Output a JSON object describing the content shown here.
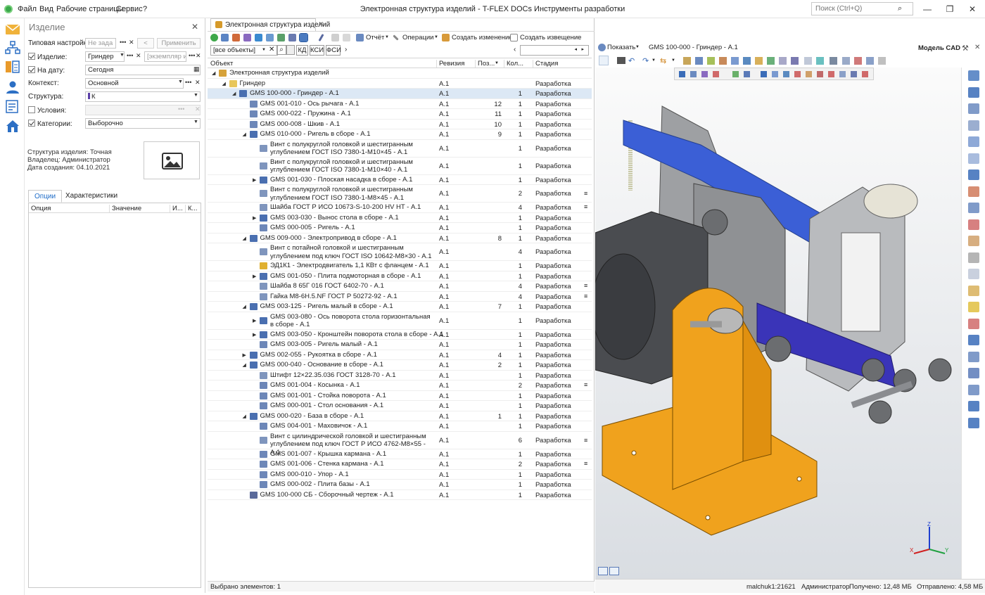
{
  "menu": [
    "Файл",
    "Вид",
    "Рабочие страницы",
    "Сервис",
    "?"
  ],
  "app_title": "Электронная структура изделий - T-FLEX DOCs Инструменты разработки",
  "search_placeholder": "Поиск (Ctrl+Q)",
  "window_buttons": {
    "min": "—",
    "max": "❐",
    "close": "✕"
  },
  "left": {
    "title": "Изделие",
    "fields": {
      "template_label": "Типовая настройка:",
      "template_value": "Не зада",
      "apply": "Применить",
      "back": "<",
      "product_label": "Изделие:",
      "product_value": "Гриндер",
      "instance_placeholder": "[экземпляр и",
      "date_label": "На дату:",
      "date_value": "Сегодня",
      "context_label": "Контекст:",
      "context_value": "Основной",
      "structure_label": "Структура:",
      "structure_value": "К",
      "conditions_label": "Условия:",
      "categories_label": "Категории:",
      "categories_value": "Выборочно"
    },
    "info": {
      "structure_label": "Структура изделия:",
      "structure_value": "Точная",
      "owner_label": "Владелец:",
      "owner_value": "Администратор",
      "created_label": "Дата создания:",
      "created_value": "04.10.2021"
    },
    "tabs": [
      "Опции",
      "Характеристики"
    ],
    "table_headers": [
      "Опция",
      "Значение",
      "И...",
      "К..."
    ]
  },
  "middle": {
    "tab_title": "Электронная структура изделий",
    "toolbar": {
      "report": "Отчёт",
      "operations": "Операции",
      "create_change": "Создать изменение",
      "create_notice": "Создать извещение"
    },
    "filter": {
      "combo": "[все объекты]",
      "kd": "КД",
      "ksi": "КСИ",
      "fsi": "ФСИ"
    },
    "columns": [
      "Объект",
      "Ревизия",
      "Поз...",
      "Кол...",
      "Стадия"
    ],
    "rows": [
      {
        "exp": "◢",
        "indent": 0,
        "type": "root",
        "name": "Электронная структура изделий",
        "rev": "",
        "pos": "",
        "qty": "",
        "stage": "",
        "mark": ""
      },
      {
        "exp": "◢",
        "indent": 1,
        "type": "folder",
        "name": "Гриндер",
        "rev": "А.1",
        "pos": "",
        "qty": "",
        "stage": "Разработка",
        "mark": ""
      },
      {
        "exp": "◢",
        "indent": 2,
        "type": "asm",
        "name": "GMS 100-000 - Гриндер - А.1",
        "rev": "А.1",
        "pos": "",
        "qty": "1",
        "stage": "Разработка",
        "mark": "",
        "sel": true
      },
      {
        "exp": "",
        "indent": 3,
        "type": "part",
        "name": "GMS 001-010 - Ось рычага - А.1",
        "rev": "А.1",
        "pos": "12",
        "qty": "1",
        "stage": "Разработка",
        "mark": ""
      },
      {
        "exp": "",
        "indent": 3,
        "type": "part",
        "name": "GMS 000-022 - Пружина - А.1",
        "rev": "А.1",
        "pos": "11",
        "qty": "1",
        "stage": "Разработка",
        "mark": ""
      },
      {
        "exp": "",
        "indent": 3,
        "type": "part",
        "name": "GMS 000-008 - Шкив - А.1",
        "rev": "А.1",
        "pos": "10",
        "qty": "1",
        "stage": "Разработка",
        "mark": ""
      },
      {
        "exp": "◢",
        "indent": 3,
        "type": "asm",
        "name": "GMS 010-000 - Ригель в сборе - А.1",
        "rev": "А.1",
        "pos": "9",
        "qty": "1",
        "stage": "Разработка",
        "mark": ""
      },
      {
        "exp": "",
        "indent": 4,
        "type": "std",
        "name": "Винт с полукруглой головкой и шестигранным углублением ГОСТ ISO 7380-1-M10×45 - А.1",
        "rev": "А.1",
        "pos": "",
        "qty": "1",
        "stage": "Разработка",
        "mark": "",
        "tall": true
      },
      {
        "exp": "",
        "indent": 4,
        "type": "std",
        "name": "Винт с полукруглой головкой и шестигранным углублением ГОСТ ISO 7380-1-M10×40 - А.1",
        "rev": "А.1",
        "pos": "",
        "qty": "1",
        "stage": "Разработка",
        "mark": "",
        "tall": true
      },
      {
        "exp": "▶",
        "indent": 4,
        "type": "asm",
        "name": "GMS 001-030 - Плоская насадка в сборе - А.1",
        "rev": "А.1",
        "pos": "",
        "qty": "1",
        "stage": "Разработка",
        "mark": ""
      },
      {
        "exp": "",
        "indent": 4,
        "type": "std",
        "name": "Винт с полукруглой головкой и шестигранным углублением ГОСТ ISO 7380-1-M8×45 - А.1",
        "rev": "А.1",
        "pos": "",
        "qty": "2",
        "stage": "Разработка",
        "mark": "≡",
        "tall": true
      },
      {
        "exp": "",
        "indent": 4,
        "type": "std",
        "name": "Шайба ГОСТ Р ИСО 10673-S-10-200 HV HT - А.1",
        "rev": "А.1",
        "pos": "",
        "qty": "4",
        "stage": "Разработка",
        "mark": "≡"
      },
      {
        "exp": "▶",
        "indent": 4,
        "type": "asm",
        "name": "GMS 003-030 - Вынос стола в сборе - А.1",
        "rev": "А.1",
        "pos": "",
        "qty": "1",
        "stage": "Разработка",
        "mark": ""
      },
      {
        "exp": "",
        "indent": 4,
        "type": "part",
        "name": "GMS 000-005 - Ригель - А.1",
        "rev": "А.1",
        "pos": "",
        "qty": "1",
        "stage": "Разработка",
        "mark": ""
      },
      {
        "exp": "◢",
        "indent": 3,
        "type": "asm",
        "name": "GMS 009-000 - Электропривод в сборе - А.1",
        "rev": "А.1",
        "pos": "8",
        "qty": "1",
        "stage": "Разработка",
        "mark": ""
      },
      {
        "exp": "",
        "indent": 4,
        "type": "std",
        "name": "Винт с потайной головкой и шестигранным углублением под ключ ГОСТ ISO 10642-M8×30 - А.1",
        "rev": "А.1",
        "pos": "",
        "qty": "4",
        "stage": "Разработка",
        "mark": "",
        "tall": true
      },
      {
        "exp": "",
        "indent": 4,
        "type": "buy",
        "name": "ЭД1К1 - Электродвигатель 1,1 КВт с фланцем - А.1",
        "rev": "А.1",
        "pos": "",
        "qty": "1",
        "stage": "Разработка",
        "mark": ""
      },
      {
        "exp": "▶",
        "indent": 4,
        "type": "asm",
        "name": "GMS 001-050 - Плита подмоторная в сборе - А.1",
        "rev": "А.1",
        "pos": "",
        "qty": "1",
        "stage": "Разработка",
        "mark": ""
      },
      {
        "exp": "",
        "indent": 4,
        "type": "std",
        "name": "Шайба 8 65Г 016 ГОСТ 6402-70 - А.1",
        "rev": "А.1",
        "pos": "",
        "qty": "4",
        "stage": "Разработка",
        "mark": "≡"
      },
      {
        "exp": "",
        "indent": 4,
        "type": "std",
        "name": "Гайка M8-6H.5.NF ГОСТ Р 50272-92 - А.1",
        "rev": "А.1",
        "pos": "",
        "qty": "4",
        "stage": "Разработка",
        "mark": "≡"
      },
      {
        "exp": "◢",
        "indent": 3,
        "type": "asm",
        "name": "GMS 003-125 - Ригель малый в сборе - А.1",
        "rev": "А.1",
        "pos": "7",
        "qty": "1",
        "stage": "Разработка",
        "mark": ""
      },
      {
        "exp": "▶",
        "indent": 4,
        "type": "asm",
        "name": "GMS 003-080 - Ось поворота стола горизонтальная в сборе - А.1",
        "rev": "А.1",
        "pos": "",
        "qty": "1",
        "stage": "Разработка",
        "mark": "",
        "tall": true
      },
      {
        "exp": "▶",
        "indent": 4,
        "type": "asm",
        "name": "GMS 003-050 - Кронштейн поворота стола в сборе - А.1",
        "rev": "А.1",
        "pos": "",
        "qty": "1",
        "stage": "Разработка",
        "mark": ""
      },
      {
        "exp": "",
        "indent": 4,
        "type": "part",
        "name": "GMS 003-005 - Ригель малый - А.1",
        "rev": "А.1",
        "pos": "",
        "qty": "1",
        "stage": "Разработка",
        "mark": ""
      },
      {
        "exp": "▶",
        "indent": 3,
        "type": "asm",
        "name": "GMS 002-055 - Рукоятка в сборе - А.1",
        "rev": "А.1",
        "pos": "4",
        "qty": "1",
        "stage": "Разработка",
        "mark": ""
      },
      {
        "exp": "◢",
        "indent": 3,
        "type": "asm",
        "name": "GMS 000-040 - Основание в сборе - А.1",
        "rev": "А.1",
        "pos": "2",
        "qty": "1",
        "stage": "Разработка",
        "mark": ""
      },
      {
        "exp": "",
        "indent": 4,
        "type": "std",
        "name": "Штифт 12×22.35.036 ГОСТ 3128-70 - А.1",
        "rev": "А.1",
        "pos": "",
        "qty": "1",
        "stage": "Разработка",
        "mark": ""
      },
      {
        "exp": "",
        "indent": 4,
        "type": "part",
        "name": "GMS 001-004 - Косынка - А.1",
        "rev": "А.1",
        "pos": "",
        "qty": "2",
        "stage": "Разработка",
        "mark": "≡"
      },
      {
        "exp": "",
        "indent": 4,
        "type": "part",
        "name": "GMS 001-001 - Стойка поворота - А.1",
        "rev": "А.1",
        "pos": "",
        "qty": "1",
        "stage": "Разработка",
        "mark": ""
      },
      {
        "exp": "",
        "indent": 4,
        "type": "part",
        "name": "GMS 000-001 - Стол основания - А.1",
        "rev": "А.1",
        "pos": "",
        "qty": "1",
        "stage": "Разработка",
        "mark": ""
      },
      {
        "exp": "◢",
        "indent": 3,
        "type": "asm",
        "name": "GMS 000-020 - База в сборе - А.1",
        "rev": "А.1",
        "pos": "1",
        "qty": "1",
        "stage": "Разработка",
        "mark": ""
      },
      {
        "exp": "",
        "indent": 4,
        "type": "part",
        "name": "GMS 004-001 - Маховичок - А.1",
        "rev": "А.1",
        "pos": "",
        "qty": "1",
        "stage": "Разработка",
        "mark": ""
      },
      {
        "exp": "",
        "indent": 4,
        "type": "std",
        "name": "Винт с цилиндрической головкой и шестигранным углублением под ключ ГОСТ Р ИСО 4762-M8×55 - А.1",
        "rev": "А.1",
        "pos": "",
        "qty": "6",
        "stage": "Разработка",
        "mark": "≡",
        "tall": true
      },
      {
        "exp": "",
        "indent": 4,
        "type": "part",
        "name": "GMS 001-007 - Крышка кармана - А.1",
        "rev": "А.1",
        "pos": "",
        "qty": "1",
        "stage": "Разработка",
        "mark": ""
      },
      {
        "exp": "",
        "indent": 4,
        "type": "part",
        "name": "GMS 001-006 - Стенка кармана - А.1",
        "rev": "А.1",
        "pos": "",
        "qty": "2",
        "stage": "Разработка",
        "mark": "≡"
      },
      {
        "exp": "",
        "indent": 4,
        "type": "part",
        "name": "GMS 000-010 - Упор - А.1",
        "rev": "А.1",
        "pos": "",
        "qty": "1",
        "stage": "Разработка",
        "mark": ""
      },
      {
        "exp": "",
        "indent": 4,
        "type": "part",
        "name": "GMS 000-002 - Плита базы - А.1",
        "rev": "А.1",
        "pos": "",
        "qty": "1",
        "stage": "Разработка",
        "mark": ""
      },
      {
        "exp": "",
        "indent": 3,
        "type": "draw",
        "name": "GMS 100-000 СБ - Сборочный чертеж - А.1",
        "rev": "А.1",
        "pos": "",
        "qty": "1",
        "stage": "Разработка",
        "mark": ""
      }
    ],
    "status": "Выбрано элементов: 1"
  },
  "right": {
    "show": "Показать",
    "doc_title": "GMS 100-000 - Гриндер - А.1",
    "cad_label": "Модель CAD",
    "axes": {
      "x": "X",
      "y": "Y",
      "z": "Z"
    }
  },
  "statusbar": {
    "user": "malchuk1:21621",
    "role": "Администратор",
    "received": "Получено: 12,48 МБ",
    "sent": "Отправлено: 4,58 МБ"
  },
  "colors": {
    "asm_icon": "#4a6fb0",
    "part_icon": "#6d87b8",
    "folder": "#e8c65a",
    "selection": "#dce8f5",
    "orange_part": "#f0a21d",
    "blue_belt": "#3b5fd6",
    "grey_part": "#a8a8a8",
    "accent": "#1e6cc8"
  }
}
